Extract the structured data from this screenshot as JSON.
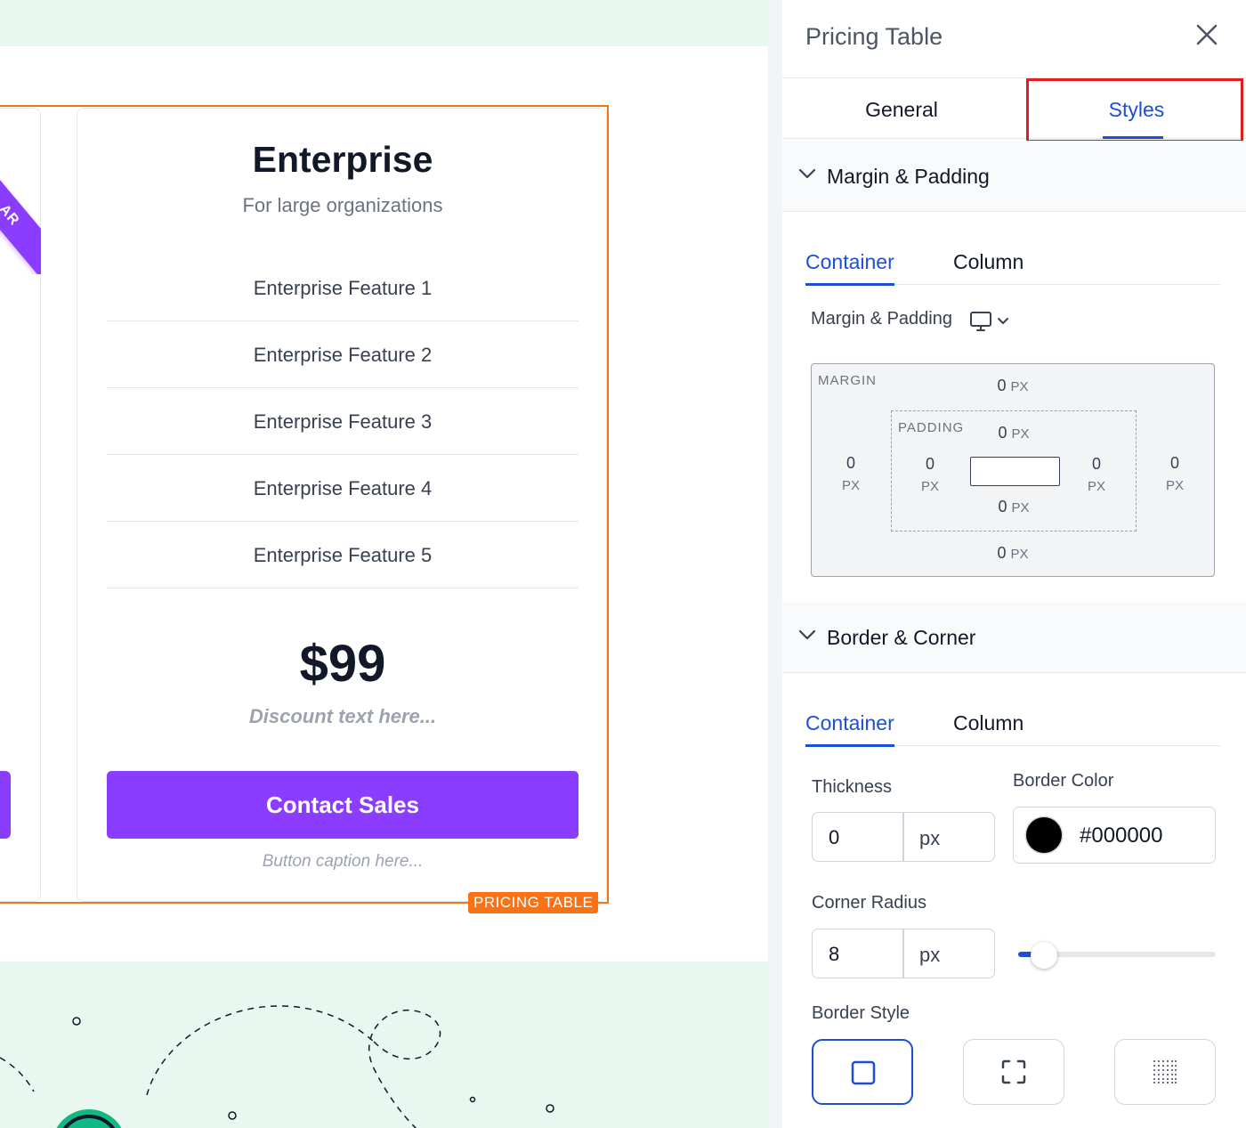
{
  "canvas": {
    "prev_card": {
      "ribbon_text": "AR"
    },
    "card": {
      "title": "Enterprise",
      "subtitle": "For large organizations",
      "features": [
        "Enterprise Feature 1",
        "Enterprise Feature 2",
        "Enterprise Feature 3",
        "Enterprise Feature 4",
        "Enterprise Feature 5"
      ],
      "price": "$99",
      "discount": "Discount text here...",
      "cta_label": "Contact Sales",
      "caption": "Button caption here..."
    },
    "selection_label": "PRICING TABLE",
    "colors": {
      "accent": "#8b3dff",
      "selection": "#f97316",
      "band": "#e9f7f1"
    }
  },
  "panel": {
    "title": "Pricing Table",
    "tabs": {
      "general": "General",
      "styles": "Styles",
      "active": "Styles"
    },
    "margin_padding": {
      "section_label": "Margin & Padding",
      "sub_tabs": [
        "Container",
        "Column"
      ],
      "active_sub_tab": "Container",
      "field_label": "Margin & Padding",
      "device": "desktop",
      "margin_title": "MARGIN",
      "padding_title": "PADDING",
      "unit": "PX",
      "margin": {
        "top": "0",
        "right": "0",
        "bottom": "0",
        "left": "0"
      },
      "padding": {
        "top": "0",
        "right": "0",
        "bottom": "0",
        "left": "0"
      }
    },
    "border_corner": {
      "section_label": "Border & Corner",
      "sub_tabs": [
        "Container",
        "Column"
      ],
      "active_sub_tab": "Container",
      "thickness_label": "Thickness",
      "thickness_value": "0",
      "thickness_unit": "px",
      "border_color_label": "Border Color",
      "border_color_value": "#000000",
      "corner_radius_label": "Corner Radius",
      "corner_radius_value": "8",
      "corner_radius_unit": "px",
      "corner_radius_slider_fraction": 0.13,
      "border_style_label": "Border Style",
      "border_styles": [
        "solid",
        "dashed",
        "dotted"
      ],
      "active_border_style": "solid"
    },
    "colors": {
      "active_tab": "#1d4ed8",
      "highlight": "#e11d1d"
    }
  }
}
